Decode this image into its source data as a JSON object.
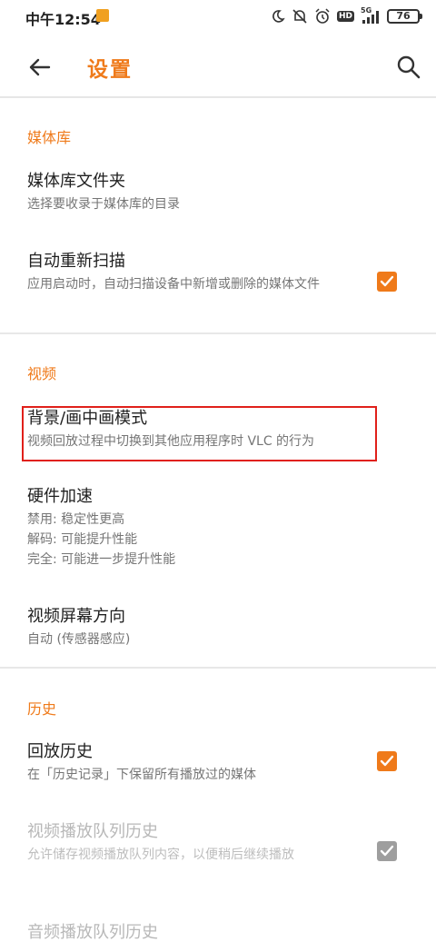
{
  "status_bar": {
    "time": "中午12:54",
    "battery": "76",
    "network": "5G",
    "hd_badge": "HD",
    "icons": [
      "moon-icon",
      "mute-icon",
      "alarm-icon",
      "hd-icon",
      "signal-icon",
      "battery-icon"
    ]
  },
  "app_bar": {
    "title": "设置",
    "back_icon": "back-arrow-icon",
    "search_icon": "search-icon"
  },
  "colors": {
    "accent": "#ef7a1a",
    "highlight_box": "#e0201a",
    "checkbox_disabled": "#9e9e9e"
  },
  "sections": [
    {
      "header": "媒体库",
      "items": [
        {
          "title": "媒体库文件夹",
          "summary": "选择要收录于媒体库的目录"
        },
        {
          "title": "自动重新扫描",
          "summary": "应用启动时，自动扫描设备中新增或删除的媒体文件",
          "checked": true
        }
      ]
    },
    {
      "header": "视频",
      "items": [
        {
          "title": "背景/画中画模式",
          "summary": "视频回放过程中切换到其他应用程序时 VLC 的行为",
          "highlighted": true
        },
        {
          "title": "硬件加速",
          "summary_lines": [
            "禁用: 稳定性更高",
            "解码: 可能提升性能",
            "完全: 可能进一步提升性能"
          ]
        },
        {
          "title": "视频屏幕方向",
          "summary": "自动 (传感器感应)"
        }
      ]
    },
    {
      "header": "历史",
      "items": [
        {
          "title": "回放历史",
          "summary": "在「历史记录」下保留所有播放过的媒体",
          "checked": true
        },
        {
          "title": "视频播放队列历史",
          "summary": "允许储存视频播放队列内容，以便稍后继续播放",
          "checked": true,
          "disabled": true
        },
        {
          "title": "音频播放队列历史",
          "disabled": true
        }
      ]
    }
  ]
}
